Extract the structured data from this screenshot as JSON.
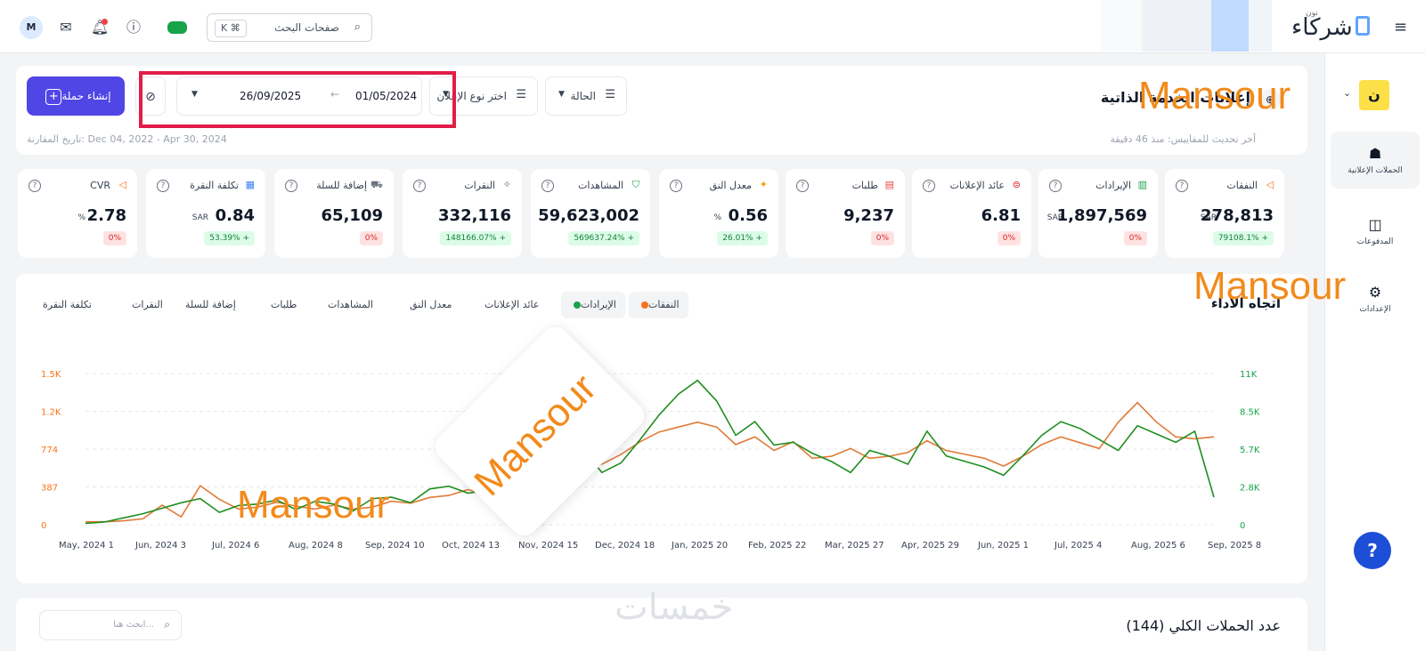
{
  "topbar": {
    "avatar_initial": "M",
    "shortcut": "K ⌘",
    "search_placeholder": "صفحات البحث",
    "brand_name": "شركاء",
    "brand_sub": "نون"
  },
  "sidebar": {
    "logo_letter": "ن",
    "items": [
      {
        "label": "الحملات الإعلانية",
        "icon": "campaigns-icon"
      },
      {
        "label": "المدفوعات",
        "icon": "wallet-icon"
      },
      {
        "label": "الإعدادات",
        "icon": "settings-icon"
      }
    ]
  },
  "header": {
    "title": "إعلانات الخدمة الذاتية",
    "last_updated": "آخر تحديث للمقاييس: منذ 46 دقيقة",
    "comparison": "تاريخ المقارنة: Dec 04, 2022 - Apr 30, 2024",
    "create_button": "إنشاء حملة",
    "date_start": "01/05/2024",
    "date_end": "26/09/2025",
    "filter_ad_type": "اختر نوع الإعلان",
    "filter_status": "الحالة"
  },
  "kpis": [
    {
      "label": "النفقات",
      "value": "278,813",
      "unit": "SAR",
      "badge": "79108.1% +",
      "badge_color": "green",
      "icon_color": "#f97316"
    },
    {
      "label": "الإيرادات",
      "value": "1,897,569",
      "unit": "SAR",
      "badge": "0%",
      "badge_color": "red",
      "icon_color": "#16a34a"
    },
    {
      "label": "عائد الإعلانات",
      "value": "6.81",
      "unit": "",
      "badge": "0%",
      "badge_color": "red",
      "icon_color": "#dc2626"
    },
    {
      "label": "طلبات",
      "value": "9,237",
      "unit": "",
      "badge": "0%",
      "badge_color": "red",
      "icon_color": "#ef4444"
    },
    {
      "label": "معدل النق",
      "value": "0.56",
      "unit": "%",
      "badge": "26.01% +",
      "badge_color": "green",
      "icon_color": "#f59e0b"
    },
    {
      "label": "المشاهدات",
      "value": "59,623,002",
      "unit": "",
      "badge": "569637.24% +",
      "badge_color": "green",
      "icon_color": "#16a34a"
    },
    {
      "label": "النقرات",
      "value": "332,116",
      "unit": "",
      "badge": "148166.07% +",
      "badge_color": "green",
      "icon_color": "#6b7280"
    },
    {
      "label": "إضافة للسلة",
      "value": "65,109",
      "unit": "",
      "badge": "0%",
      "badge_color": "red",
      "icon_color": "#6b7280"
    },
    {
      "label": "تكلفة النقرة",
      "value": "0.84",
      "unit": "SAR",
      "badge": "53.39% +",
      "badge_color": "green",
      "icon_color": "#3b82f6"
    },
    {
      "label": "CVR",
      "value": "2.78",
      "unit": "%",
      "badge": "0%",
      "badge_color": "red",
      "icon_color": "#f97316"
    }
  ],
  "chart_panel": {
    "title": "اتجاه الأداء",
    "tabs": [
      {
        "label": "النفقات",
        "dot": "#f97316",
        "selected": true
      },
      {
        "label": "الإيرادات",
        "dot": "#16a34a",
        "selected": true
      },
      {
        "label": "عائد الإعلانات",
        "dot": "",
        "selected": false
      },
      {
        "label": "معدل النق",
        "dot": "",
        "selected": false
      },
      {
        "label": "المشاهدات",
        "dot": "",
        "selected": false
      },
      {
        "label": "طلبات",
        "dot": "",
        "selected": false
      },
      {
        "label": "إضافة للسلة",
        "dot": "",
        "selected": false
      },
      {
        "label": "النقرات",
        "dot": "",
        "selected": false
      },
      {
        "label": "تكلفة النقرة",
        "dot": "",
        "selected": false
      }
    ]
  },
  "chart_data": {
    "type": "line",
    "x": [
      "May, 2024 1",
      "Jun, 2024 3",
      "Jul, 2024 6",
      "Aug, 2024 8",
      "Sep, 2024 10",
      "Oct, 2024 13",
      "Nov, 2024 15",
      "Dec, 2024 18",
      "Jan, 2025 20",
      "Feb, 2025 22",
      "Mar, 2025 27",
      "Apr, 2025 29",
      "Jun, 2025 1",
      "Jul, 2025 4",
      "Aug, 2025 6",
      "Sep, 2025 8"
    ],
    "left_axis_ticks": [
      "0",
      "387",
      "774",
      "1.2K",
      "1.5K"
    ],
    "right_axis_ticks": [
      "0",
      "2.8K",
      "5.7K",
      "8.5K",
      "11K"
    ],
    "left_axis_range": [
      0,
      1548
    ],
    "right_axis_range": [
      0,
      11000
    ],
    "grid": true,
    "series": [
      {
        "name": "النفقات",
        "axis": "left",
        "color": "#e07b39",
        "values": [
          30,
          30,
          40,
          60,
          200,
          80,
          400,
          260,
          160,
          180,
          230,
          190,
          160,
          200,
          160,
          180,
          240,
          220,
          280,
          300,
          360,
          300,
          420,
          600,
          480,
          700,
          560,
          620,
          720,
          850,
          950,
          1000,
          1050,
          1000,
          820,
          900,
          760,
          850,
          680,
          700,
          780,
          680,
          700,
          740,
          860,
          760,
          720,
          680,
          600,
          700,
          820,
          900,
          840,
          780,
          1050,
          1250,
          1050,
          900,
          880,
          900
        ]
      },
      {
        "name": "الإيرادات",
        "axis": "right",
        "color": "#1f8f1f",
        "values": [
          100,
          200,
          500,
          800,
          1200,
          1600,
          1900,
          900,
          1400,
          1500,
          1800,
          1100,
          1700,
          1500,
          1000,
          1900,
          2000,
          1600,
          2600,
          2800,
          2300,
          2500,
          1800,
          3200,
          2400,
          3800,
          5500,
          3800,
          4500,
          6200,
          8000,
          9500,
          10500,
          9000,
          6500,
          7500,
          5800,
          6000,
          5200,
          4600,
          3800,
          5400,
          5000,
          4400,
          6800,
          5000,
          4600,
          4200,
          3600,
          5000,
          6500,
          7500,
          7000,
          6200,
          5400,
          7200,
          6600,
          6000,
          6800,
          2000
        ]
      }
    ]
  },
  "campaigns": {
    "title": "عدد الحملات الكلي (144)",
    "search_placeholder": "ابحث هنا..."
  },
  "help_label": "?",
  "watermark": {
    "text": "Mansour",
    "logo": "خمسات"
  }
}
